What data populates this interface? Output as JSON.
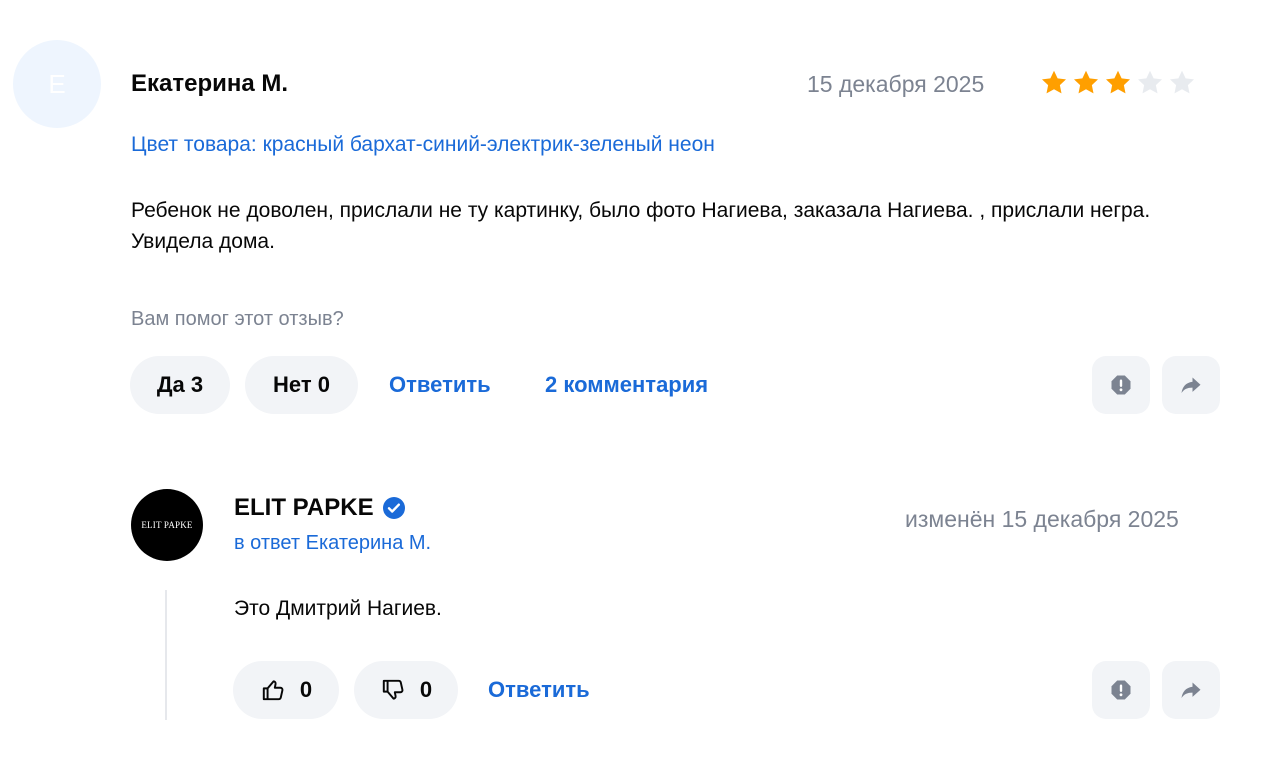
{
  "review": {
    "avatar_letter": "Е",
    "author": "Екатерина М.",
    "date": "15 декабря 2025",
    "rating": 3,
    "rating_max": 5,
    "variant": "Цвет товара: красный бархат-синий-электрик-зеленый неон",
    "text": "Ребенок не доволен, прислали не ту картинку, было фото Нагиева, заказала Нагиева. , прислали негра. Увидела дома.",
    "helpful_question": "Вам помог этот отзыв?",
    "yes_label": "Да 3",
    "no_label": "Нет 0",
    "reply_label": "Ответить",
    "comments_label": "2 комментария"
  },
  "seller_reply": {
    "avatar_text": "ELIT PAPKE",
    "name": "ELIT PAPKE",
    "in_reply_to": "в ответ Екатерина М.",
    "edited_date": "изменён 15 декабря 2025",
    "text": "Это Дмитрий Нагиев.",
    "likes": "0",
    "dislikes": "0",
    "reply_label": "Ответить"
  },
  "icons": {
    "star": "star-icon",
    "report": "report-icon",
    "share": "share-icon",
    "verified": "verified-check-icon",
    "like": "thumbs-up-icon",
    "dislike": "thumbs-down-icon"
  },
  "colors": {
    "accent": "#1a6ad8",
    "star_filled": "#ff9f00",
    "star_empty": "#e8ebef",
    "muted_text": "#7c8391",
    "pill_bg": "#f2f4f7"
  }
}
